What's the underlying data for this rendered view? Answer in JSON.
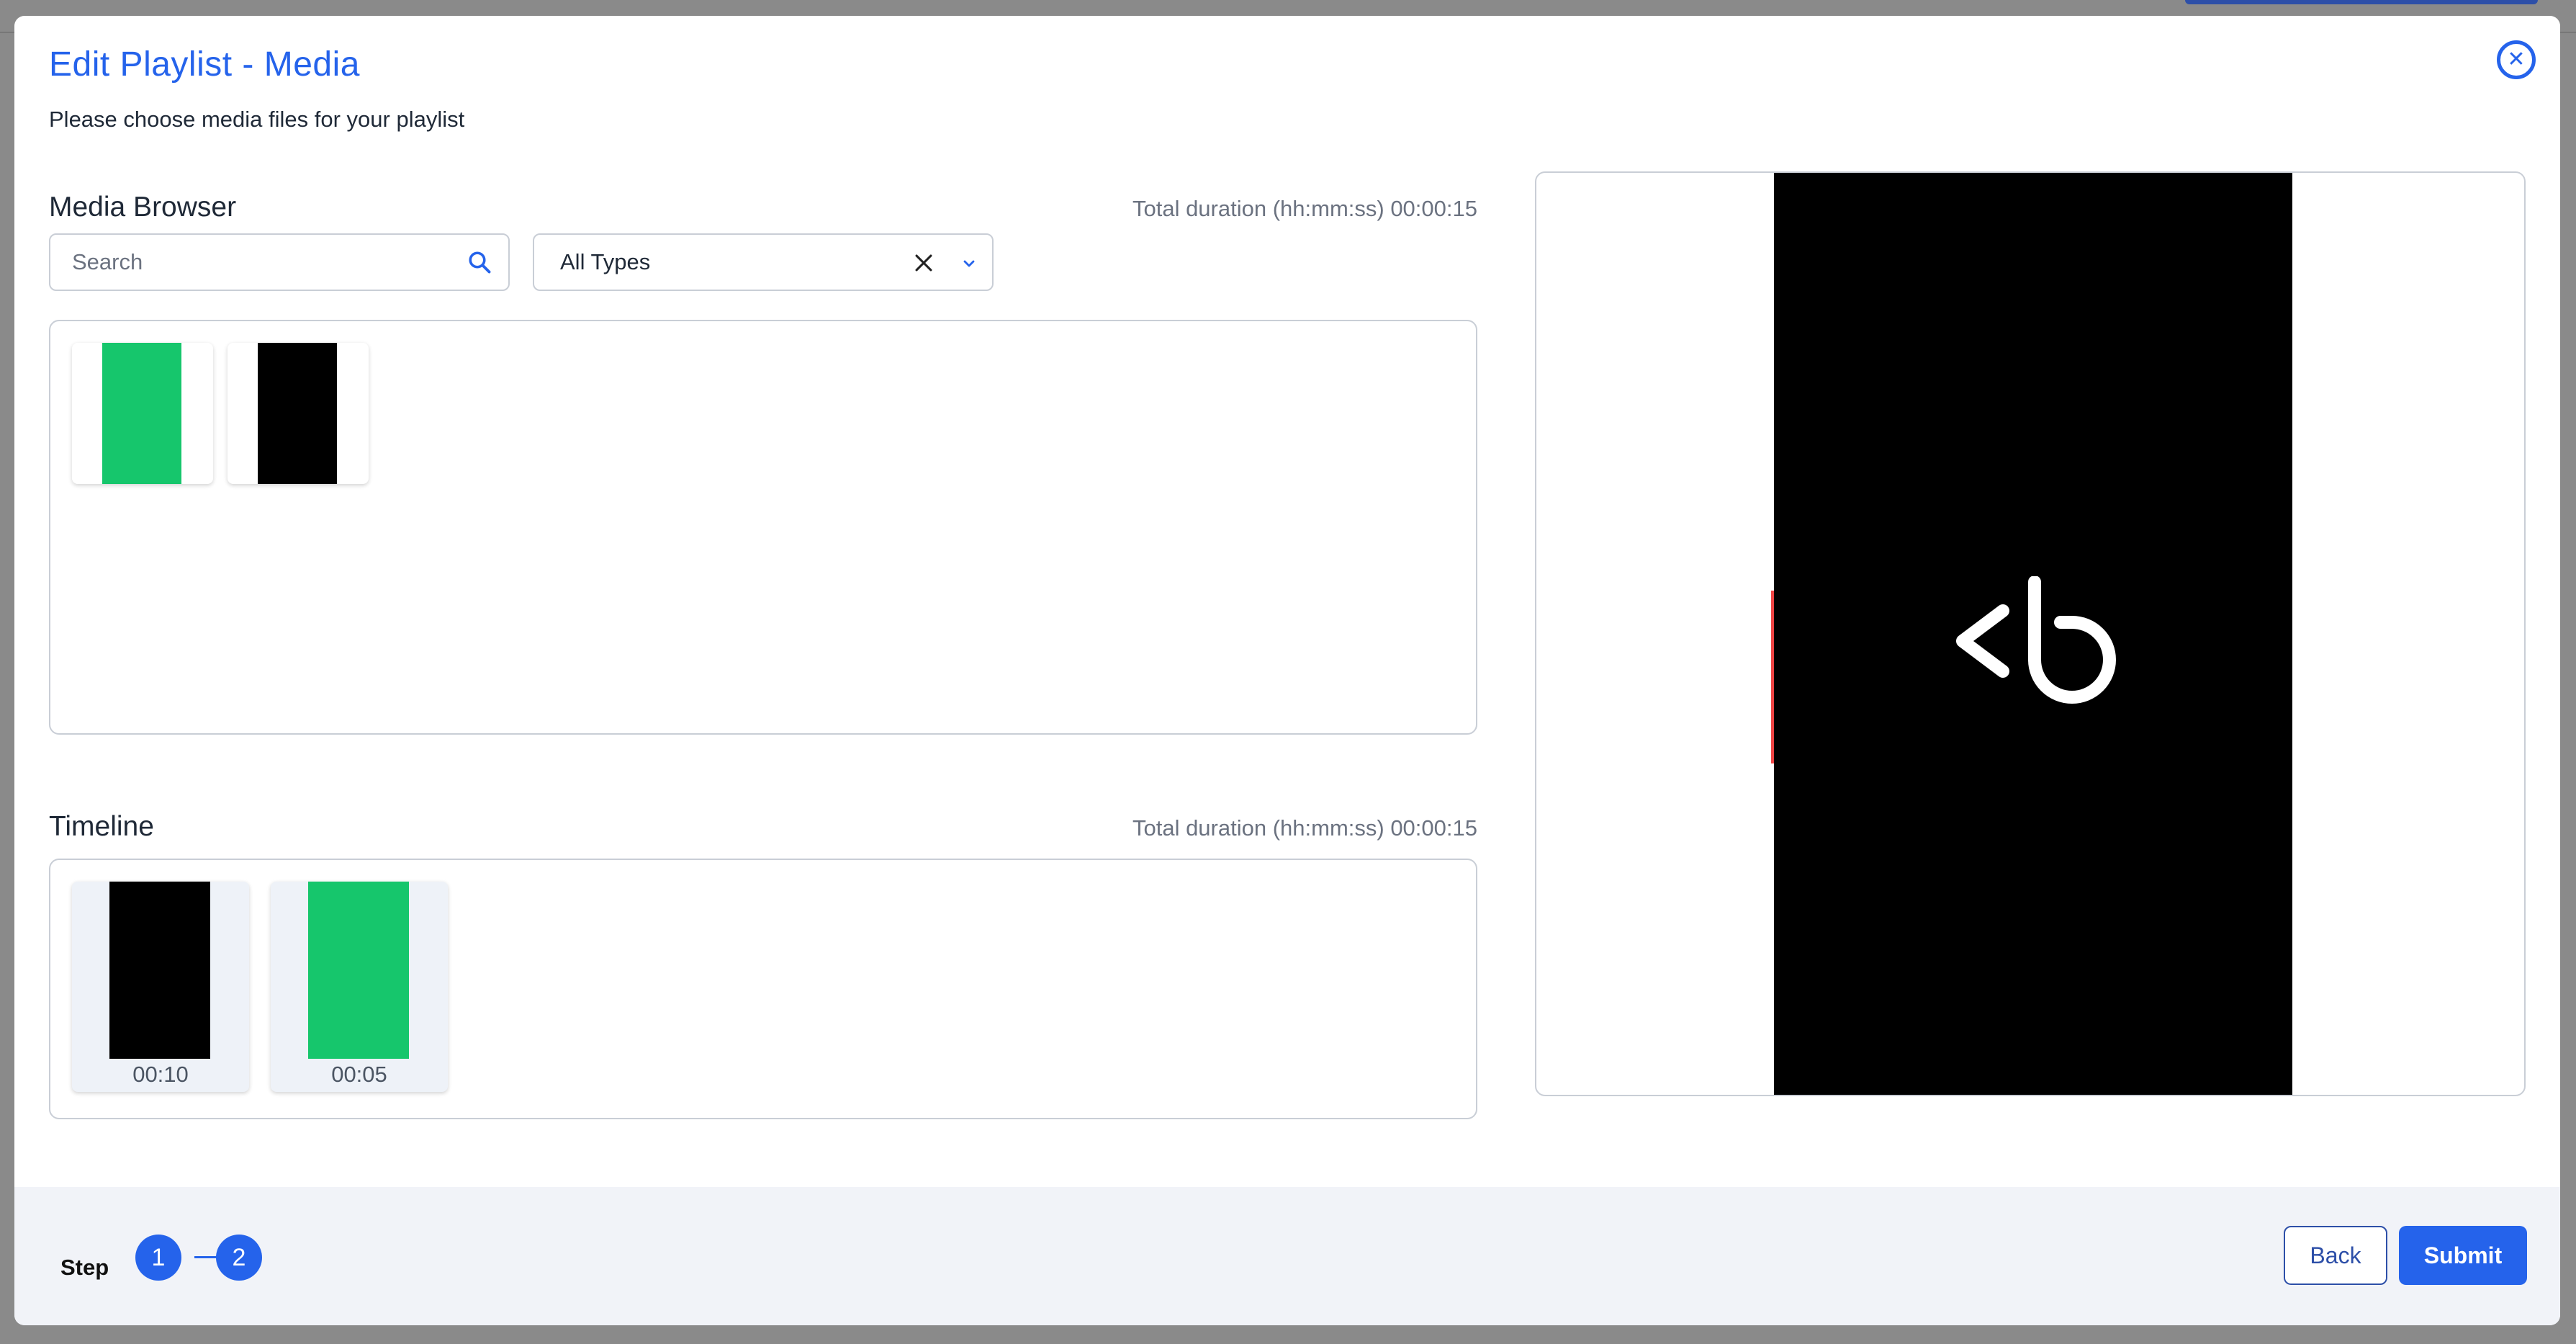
{
  "modal": {
    "title": "Edit Playlist - Media",
    "subtitle": "Please choose media files for your playlist",
    "close_icon": "close-circle-icon"
  },
  "media_browser": {
    "title": "Media Browser",
    "total_duration": "Total duration (hh:mm:ss) 00:00:15",
    "search": {
      "placeholder": "Search",
      "value": ""
    },
    "type_filter": {
      "selected": "All Types"
    },
    "items": [
      {
        "color": "#16c66c"
      },
      {
        "color": "#000000"
      }
    ]
  },
  "timeline": {
    "title": "Timeline",
    "total_duration": "Total duration (hh:mm:ss) 00:00:15",
    "items": [
      {
        "color": "#000000",
        "duration": "00:10"
      },
      {
        "color": "#16c66c",
        "duration": "00:05"
      }
    ]
  },
  "preview": {
    "background": "#000000",
    "logo_icon": "brand-logo-icon"
  },
  "footer": {
    "step_label": "Step",
    "steps": [
      "1",
      "2"
    ],
    "back_label": "Back",
    "submit_label": "Submit"
  },
  "colors": {
    "accent": "#2563eb",
    "accent_dark": "#2d4fa8",
    "green": "#16c66c"
  }
}
